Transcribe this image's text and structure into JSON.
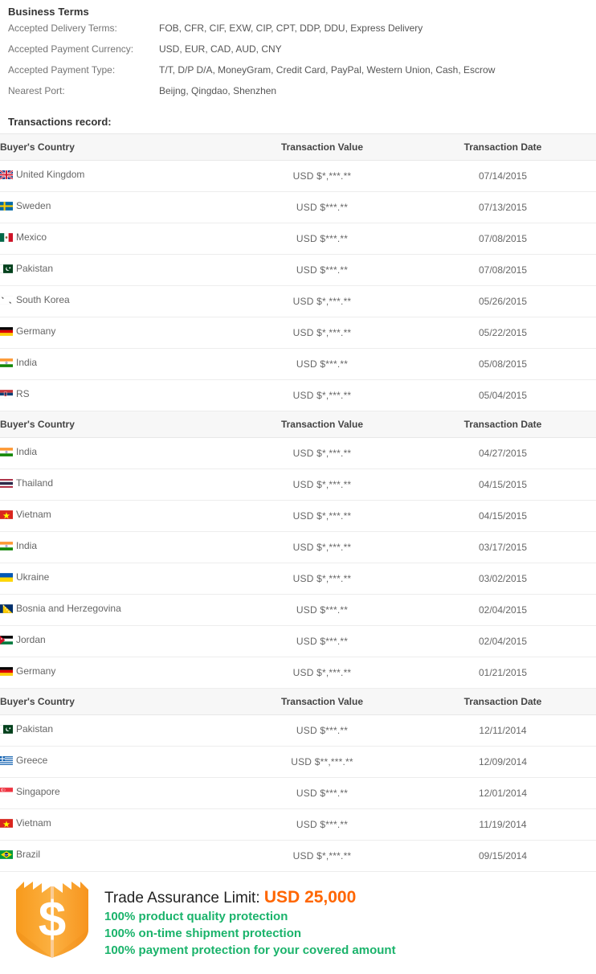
{
  "business_terms": {
    "title": "Business Terms",
    "rows": [
      {
        "label": "Accepted Delivery Terms:",
        "value": "FOB, CFR, CIF, EXW, CIP, CPT, DDP, DDU, Express Delivery"
      },
      {
        "label": "Accepted Payment Currency:",
        "value": "USD, EUR, CAD, AUD, CNY"
      },
      {
        "label": "Accepted Payment Type:",
        "value": "T/T, D/P D/A, MoneyGram, Credit Card, PayPal, Western Union, Cash, Escrow"
      },
      {
        "label": "Nearest Port:",
        "value": "Beijng, Qingdao, Shenzhen"
      }
    ]
  },
  "transactions": {
    "title": "Transactions record:",
    "columns": [
      "Buyer's Country",
      "Transaction Value",
      "Transaction Date"
    ],
    "groups": [
      {
        "rows": [
          {
            "flag": "gb",
            "country": "United Kingdom",
            "value": "USD $*,***.**",
            "date": "07/14/2015"
          },
          {
            "flag": "se",
            "country": "Sweden",
            "value": "USD $***.**",
            "date": "07/13/2015"
          },
          {
            "flag": "mx",
            "country": "Mexico",
            "value": "USD $***.**",
            "date": "07/08/2015"
          },
          {
            "flag": "pk",
            "country": "Pakistan",
            "value": "USD $***.**",
            "date": "07/08/2015"
          },
          {
            "flag": "kr",
            "country": "South Korea",
            "value": "USD $*,***.**",
            "date": "05/26/2015"
          },
          {
            "flag": "de",
            "country": "Germany",
            "value": "USD $*,***.**",
            "date": "05/22/2015"
          },
          {
            "flag": "in",
            "country": "India",
            "value": "USD $***.**",
            "date": "05/08/2015"
          },
          {
            "flag": "rs",
            "country": "RS",
            "value": "USD $*,***.**",
            "date": "05/04/2015"
          }
        ]
      },
      {
        "rows": [
          {
            "flag": "in",
            "country": "India",
            "value": "USD $*,***.**",
            "date": "04/27/2015"
          },
          {
            "flag": "th",
            "country": "Thailand",
            "value": "USD $*,***.**",
            "date": "04/15/2015"
          },
          {
            "flag": "vn",
            "country": "Vietnam",
            "value": "USD $*,***.**",
            "date": "04/15/2015"
          },
          {
            "flag": "in",
            "country": "India",
            "value": "USD $*,***.**",
            "date": "03/17/2015"
          },
          {
            "flag": "ua",
            "country": "Ukraine",
            "value": "USD $*,***.**",
            "date": "03/02/2015"
          },
          {
            "flag": "ba",
            "country": "Bosnia and Herzegovina",
            "value": "USD $***.**",
            "date": "02/04/2015"
          },
          {
            "flag": "jo",
            "country": "Jordan",
            "value": "USD $***.**",
            "date": "02/04/2015"
          },
          {
            "flag": "de",
            "country": "Germany",
            "value": "USD $*,***.**",
            "date": "01/21/2015"
          }
        ]
      },
      {
        "rows": [
          {
            "flag": "pk",
            "country": "Pakistan",
            "value": "USD $***.**",
            "date": "12/11/2014"
          },
          {
            "flag": "gr",
            "country": "Greece",
            "value": "USD $**,***.**",
            "date": "12/09/2014"
          },
          {
            "flag": "sg",
            "country": "Singapore",
            "value": "USD $***.**",
            "date": "12/01/2014"
          },
          {
            "flag": "vn",
            "country": "Vietnam",
            "value": "USD $***.**",
            "date": "11/19/2014"
          },
          {
            "flag": "br",
            "country": "Brazil",
            "value": "USD $*,***.**",
            "date": "09/15/2014"
          }
        ]
      }
    ]
  },
  "trade_assurance": {
    "icon": "trade-assurance-shield-icon",
    "limit_label": "Trade Assurance Limit:",
    "limit_amount": "USD 25,000",
    "benefits": [
      "100% product quality protection",
      "100% on-time shipment protection",
      "100% payment protection for your covered amount"
    ],
    "colors": {
      "amount": "#ff6600",
      "benefit": "#1ab36b",
      "badge": "#f7a21b"
    }
  }
}
